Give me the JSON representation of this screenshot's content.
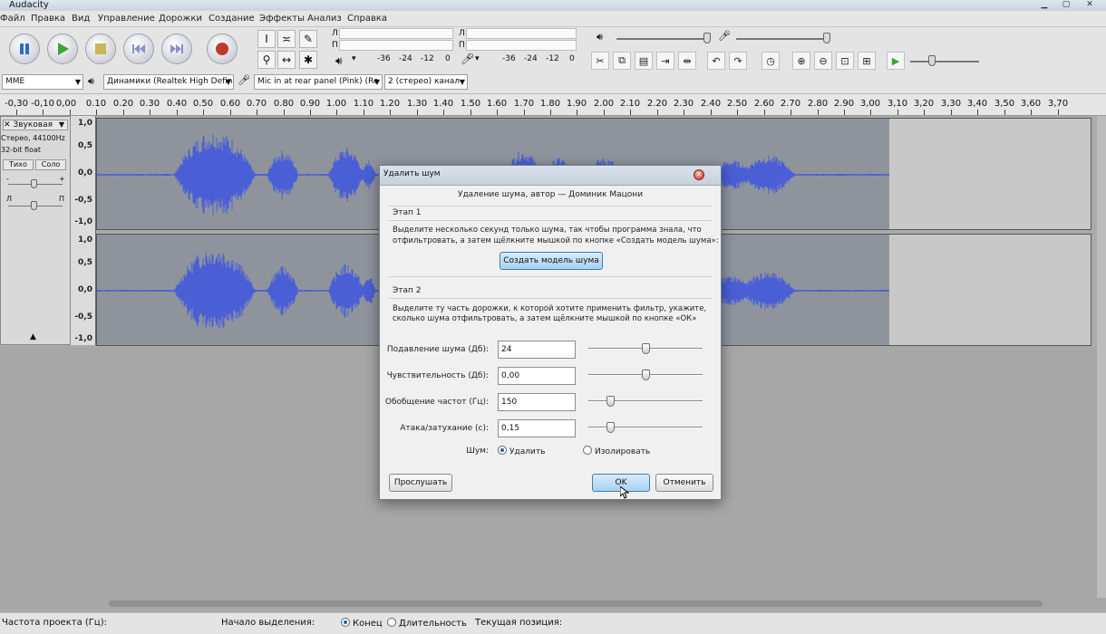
{
  "window": {
    "title": "Audacity"
  },
  "menu": [
    "Файл",
    "Правка",
    "Вид",
    "Управление",
    "Дорожки",
    "Создание",
    "Эффекты",
    "Анализ",
    "Справка"
  ],
  "meters": {
    "play_scale": [
      "-36",
      "-24",
      "-12",
      "0"
    ],
    "rec_scale": [
      "-36",
      "-24",
      "-12",
      "0"
    ],
    "channel_left": "Л",
    "channel_right": "П"
  },
  "devices": {
    "host": "MME",
    "output": "Динамики (Realtek High Defin",
    "input": "Mic in at rear panel (Pink) (Re",
    "channels": "2 (стерео) канал"
  },
  "ruler": [
    "-0,30",
    "-0,10",
    "0,00",
    "0.10",
    "0.20",
    "0.30",
    "0.40",
    "0.50",
    "0.60",
    "0.70",
    "0.80",
    "0.90",
    "1.00",
    "1.10",
    "1.20",
    "1.30",
    "1.40",
    "1.50",
    "1.60",
    "1.70",
    "1.80",
    "1.90",
    "2.00",
    "2.10",
    "2.20",
    "2.30",
    "2.40",
    "2.50",
    "2.60",
    "2.70",
    "2.80",
    "2.90",
    "3,00",
    "3,10",
    "3,20",
    "3,30",
    "3,40",
    "3,50",
    "3,60",
    "3,70"
  ],
  "track": {
    "name": "Звуковая",
    "format_line1": "Стерео, 44100Hz",
    "format_line2": "32-bit float",
    "mute": "Тихо",
    "solo": "Соло",
    "gain_l": "-",
    "gain_r": "+",
    "pan_l": "Л",
    "pan_r": "П",
    "scale_top": [
      "1,0",
      "0,5",
      "0,0",
      "-0,5",
      "-1,0"
    ],
    "scale_bottom": [
      "1,0",
      "0,5",
      "0,0",
      "-0,5",
      "-1,0"
    ]
  },
  "dialog": {
    "title": "Удалить шум",
    "credit": "Удаление шума, автор — Доминик Мацони",
    "step1_title": "Этап 1",
    "step1_text1": "Выделите несколько секунд только шума, так чтобы программа знала, что",
    "step1_text2": "отфильтровать, а затем щёлкните мышкой по кнопке «Создать модель шума»:",
    "create_profile_button": "Создать модель шума",
    "step2_title": "Этап 2",
    "step2_text1": "Выделите ту часть дорожки, к которой хотите применить фильтр, укажите,",
    "step2_text2": "сколько шума отфильтровать, а затем щёлкните мышкой по кнопке «ОК»",
    "params": [
      {
        "label": "Подавление шума (Дб):",
        "value": "24",
        "level": 0.5
      },
      {
        "label": "Чувствительность (Дб):",
        "value": "0,00",
        "level": 0.5
      },
      {
        "label": "Обобщение частот (Гц):",
        "value": "150",
        "level": 0.17
      },
      {
        "label": "Атака/затухание (с):",
        "value": "0,15",
        "level": 0.17
      }
    ],
    "noise_label": "Шум:",
    "noise_remove": "Удалить",
    "noise_isolate": "Изолировать",
    "preview_button": "Прослушать",
    "ok_button": "OK",
    "cancel_button": "Отменить"
  },
  "status": {
    "project_rate_label": "Частота проекта (Гц):",
    "selection_start_label": "Начало выделения:",
    "end_option": "Конец",
    "length_option": "Длительность",
    "position_label": "Текущая позиция:"
  },
  "colors": {
    "waveform": "#4a5fd6",
    "selection": "#8f949c",
    "track_bg": "#c8c8c8",
    "accent": "#2a5db0"
  }
}
